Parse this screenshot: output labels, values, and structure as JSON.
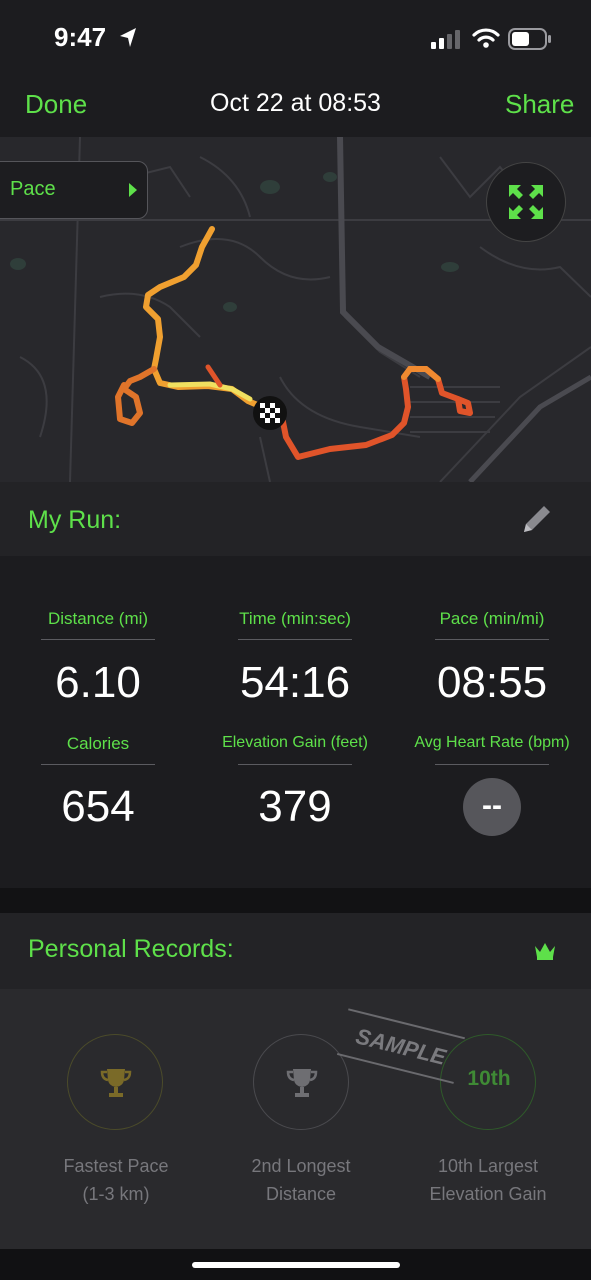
{
  "status_bar": {
    "time": "9:47"
  },
  "nav": {
    "done": "Done",
    "title": "Oct 22 at 08:53",
    "share": "Share"
  },
  "map": {
    "pace_label": "Pace"
  },
  "run": {
    "title": "My Run:"
  },
  "stats": [
    {
      "label": "Distance (mi)",
      "value": "6.10"
    },
    {
      "label": "Time (min:sec)",
      "value": "54:16"
    },
    {
      "label": "Pace (min/mi)",
      "value": "08:55"
    },
    {
      "label": "Calories",
      "value": "654"
    },
    {
      "label": "Elevation Gain (feet)",
      "value": "379"
    },
    {
      "label": "Avg Heart Rate (bpm)",
      "value": "--"
    }
  ],
  "records": {
    "title": "Personal Records:",
    "sample_stamp": "SAMPLE",
    "items": [
      {
        "line1": "Fastest Pace",
        "line2": "(1-3 km)",
        "badge_icon": "trophy-icon"
      },
      {
        "line1": "2nd Longest",
        "line2": "Distance",
        "badge_icon": "trophy-icon"
      },
      {
        "line1": "10th Largest",
        "line2": "Elevation Gain",
        "badge_text": "10th"
      }
    ]
  },
  "colors": {
    "accent": "#5ee04a",
    "background": "#1c1c1f",
    "route_hot": "#e0542a",
    "route_warm": "#f0a030",
    "route_light": "#f0e060"
  }
}
